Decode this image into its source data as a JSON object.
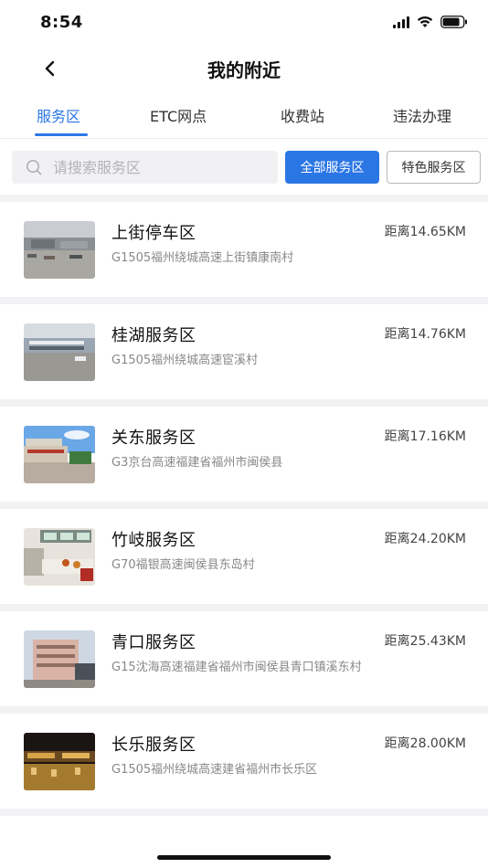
{
  "status_bar": {
    "time": "8:54"
  },
  "nav": {
    "title": "我的附近"
  },
  "tabs": [
    {
      "label": "服务区"
    },
    {
      "label": "ETC网点"
    },
    {
      "label": "收费站"
    },
    {
      "label": "违法办理"
    }
  ],
  "search": {
    "placeholder": "请搜索服务区",
    "value": ""
  },
  "filters": {
    "all_label": "全部服务区",
    "special_label": "特色服务区"
  },
  "items": [
    {
      "name": "上街停车区",
      "address": "G1505福州绕城高速上街镇康南村",
      "distance": "距离14.65KM"
    },
    {
      "name": "桂湖服务区",
      "address": "G1505福州绕城高速宦溪村",
      "distance": "距离14.76KM"
    },
    {
      "name": "关东服务区",
      "address": "G3京台高速福建省福州市闽侯县",
      "distance": "距离17.16KM"
    },
    {
      "name": "竹岐服务区",
      "address": "G70福银高速闽侯县东岛村",
      "distance": "距离24.20KM"
    },
    {
      "name": "青口服务区",
      "address": "G15沈海高速福建省福州市闽侯县青口镇溪东村",
      "distance": "距离25.43KM"
    },
    {
      "name": "长乐服务区",
      "address": "G1505福州绕城高速建省福州市长乐区",
      "distance": "距离28.00KM"
    }
  ],
  "colors": {
    "accent": "#2b76e5",
    "list_bg": "#f2f2f4"
  }
}
